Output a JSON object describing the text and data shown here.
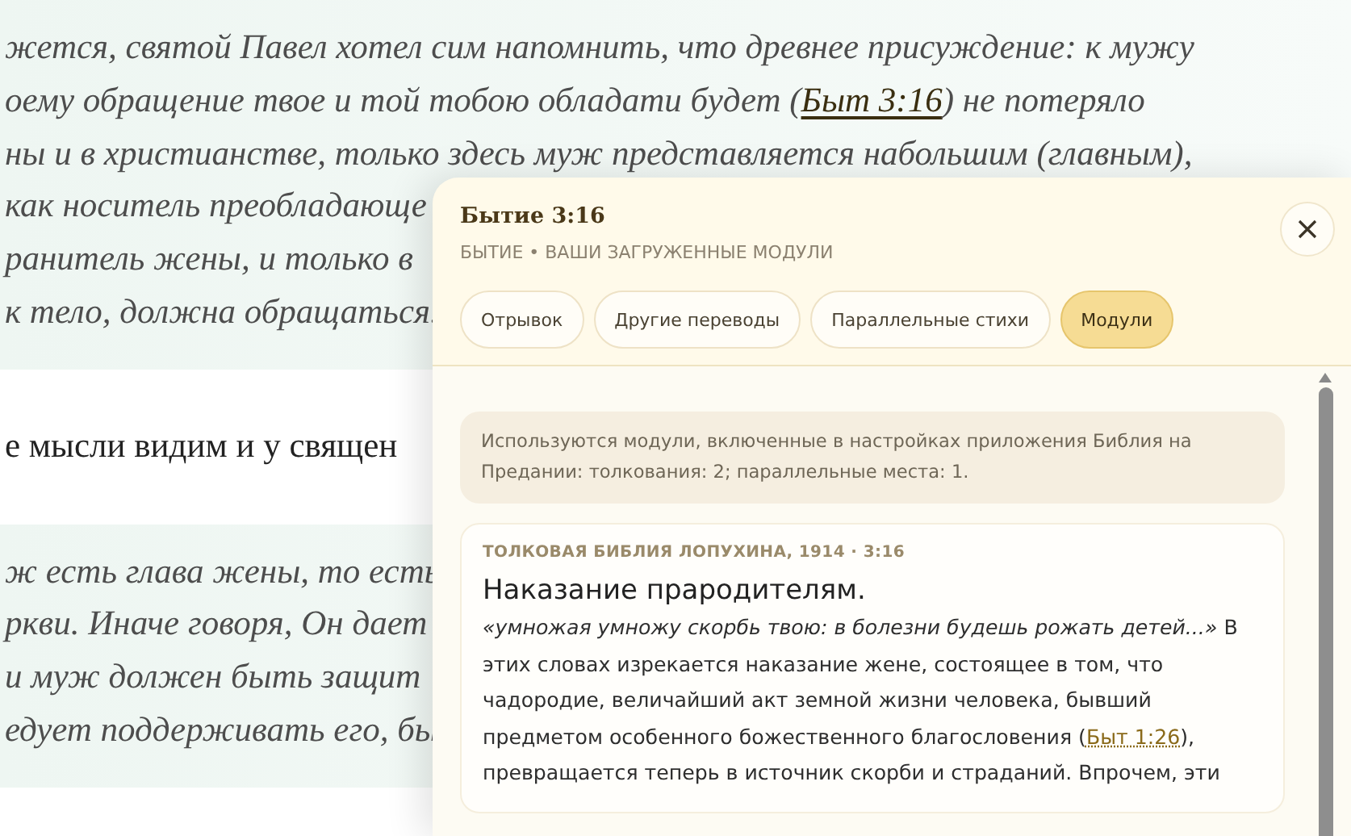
{
  "article": {
    "blocks": [
      {
        "kind": "quote",
        "lines": [
          {
            "text": "жется, святой Павел хотел сим напомнить, что древнее присуждение: к мужу"
          },
          {
            "text": "оему обращение твое и той тобою обладати будет (",
            "link": "Быт 3:16",
            "after": ") не потеряло"
          },
          {
            "text": "ны и в христианстве, только здесь муж представляется набольшим (главным),"
          },
          {
            "text": "как носитель преобладающе"
          },
          {
            "text": "ранитель жены, и только в"
          },
          {
            "text": "к тело, должна обращаться."
          }
        ]
      },
      {
        "kind": "text",
        "lines": [
          {
            "text": "е мысли видим и у священ"
          }
        ]
      },
      {
        "kind": "quote",
        "lines": [
          {
            "text": "ж есть глава жены, то есть"
          },
          {
            "text": "ркви. Иначе говоря, Он дает"
          },
          {
            "text": "и муж должен быть защит"
          },
          {
            "text": "едует поддерживать его, бы"
          }
        ]
      }
    ]
  },
  "popup": {
    "title": "Бытие 3:16",
    "subtitle": "БЫТИЕ • ВАШИ ЗАГРУЖЕННЫЕ МОДУЛИ",
    "tabs": [
      {
        "label": "Отрывок",
        "selected": false
      },
      {
        "label": "Другие переводы",
        "selected": false
      },
      {
        "label": "Параллельные стихи",
        "selected": false
      },
      {
        "label": "Модули",
        "selected": true
      }
    ],
    "notice": "Используются модули, включенные в настройках приложения Библия на Предании: толкования: 2; параллельные места: 1.",
    "entries": [
      {
        "source": "ТОЛКОВАЯ БИБЛИЯ ЛОПУХИНА, 1914 · 3:16",
        "heading": "Наказание прародителям.",
        "text_before": "*«умножая умножу скорбь твою: в болезни будешь рожать детей...»* В этих словах изрекается наказание жене, состоящее в том, что чадородие, величайший акт земной жизни человека, бывший предметом особенного божественного благословения (",
        "link": "Быт 1:26",
        "text_after": "), превращается теперь в источник скорби и страданий. Впрочем, эти"
      }
    ]
  }
}
